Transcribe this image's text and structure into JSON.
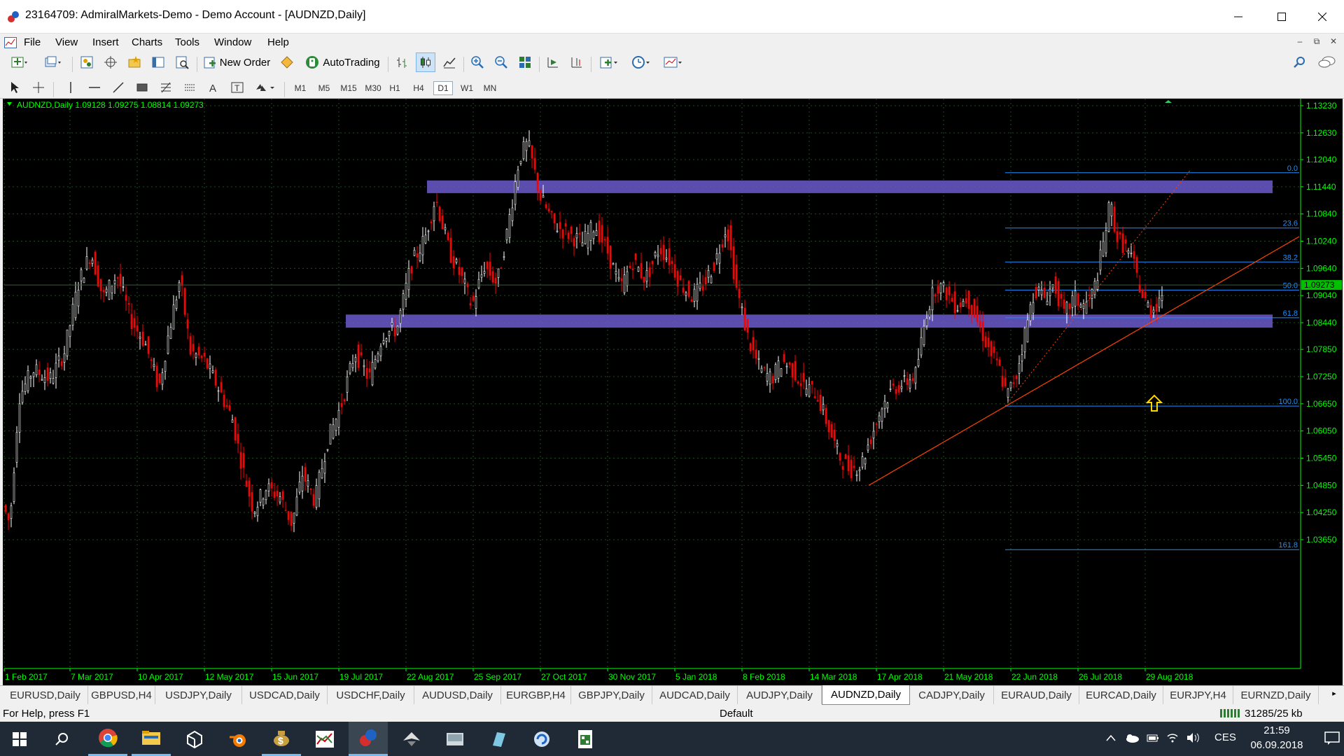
{
  "window": {
    "title": "23164709: AdmiralMarkets-Demo - Demo Account - [AUDNZD,Daily]"
  },
  "menu": [
    "File",
    "View",
    "Insert",
    "Charts",
    "Tools",
    "Window",
    "Help"
  ],
  "toolbar": {
    "new_order": "New Order",
    "auto_trading": "AutoTrading"
  },
  "timeframes": [
    "M1",
    "M5",
    "M15",
    "M30",
    "H1",
    "H4",
    "D1",
    "W1",
    "MN"
  ],
  "active_timeframe": "D1",
  "chart": {
    "info": "AUDNZD,Daily  1.09128 1.09275 1.08814 1.09273",
    "price_labels": [
      "1.13230",
      "1.12630",
      "1.12040",
      "1.11440",
      "1.10840",
      "1.10240",
      "1.09640",
      "1.09040",
      "1.08440",
      "1.07850",
      "1.07250",
      "1.06650",
      "1.06050",
      "1.05450",
      "1.04850",
      "1.04250",
      "1.03650"
    ],
    "price_values": [
      1.1323,
      1.1263,
      1.1204,
      1.1144,
      1.1084,
      1.1024,
      1.0964,
      1.0904,
      1.0844,
      1.0785,
      1.0725,
      1.0665,
      1.0605,
      1.0545,
      1.0485,
      1.0425,
      1.0365
    ],
    "current_price": "1.09273",
    "current_value": 1.09273,
    "date_labels": [
      "1 Feb 2017",
      "7 Mar 2017",
      "10 Apr 2017",
      "12 May 2017",
      "15 Jun 2017",
      "19 Jul 2017",
      "22 Aug 2017",
      "25 Sep 2017",
      "27 Oct 2017",
      "30 Nov 2017",
      "5 Jan 2018",
      "8 Feb 2018",
      "14 Mar 2018",
      "17 Apr 2018",
      "21 May 2018",
      "22 Jun 2018",
      "26 Jul 2018",
      "29 Aug 2018"
    ],
    "fibo_levels": [
      {
        "label": "0.0",
        "value": 1.1175
      },
      {
        "label": "23.6",
        "value": 1.1053
      },
      {
        "label": "38.2",
        "value": 1.0978
      },
      {
        "label": "50.0",
        "value": 1.0916
      },
      {
        "label": "61.8",
        "value": 1.0855
      },
      {
        "label": "100.0",
        "value": 1.066
      },
      {
        "label": "161.8",
        "value": 1.0343
      }
    ],
    "zones": [
      {
        "from": 1.113,
        "to": 1.1158
      },
      {
        "from": 1.0833,
        "to": 1.0862
      }
    ],
    "colors": {
      "background": "#000000",
      "bull": "#ffffff",
      "bear": "#ff0000",
      "zone": "#6a5acd",
      "fibo": "#1e90ff",
      "trend": "#ff4500",
      "arrow": "#ffd700",
      "axis": "#00ff00"
    }
  },
  "tabs": [
    "EURUSD,Daily",
    "GBPUSD,H4",
    "USDJPY,Daily",
    "USDCAD,Daily",
    "USDCHF,Daily",
    "AUDUSD,Daily",
    "EURGBP,H4",
    "GBPJPY,Daily",
    "AUDCAD,Daily",
    "AUDJPY,Daily",
    "AUDNZD,Daily",
    "CADJPY,Daily",
    "EURAUD,Daily",
    "EURCAD,Daily",
    "EURJPY,H4",
    "EURNZD,Daily"
  ],
  "active_tab": "AUDNZD,Daily",
  "status": {
    "help": "For Help, press F1",
    "profile": "Default",
    "traffic": "31285/25 kb"
  },
  "taskbar": {
    "lang": "CES",
    "time": "21:59",
    "date": "06.09.2018"
  }
}
